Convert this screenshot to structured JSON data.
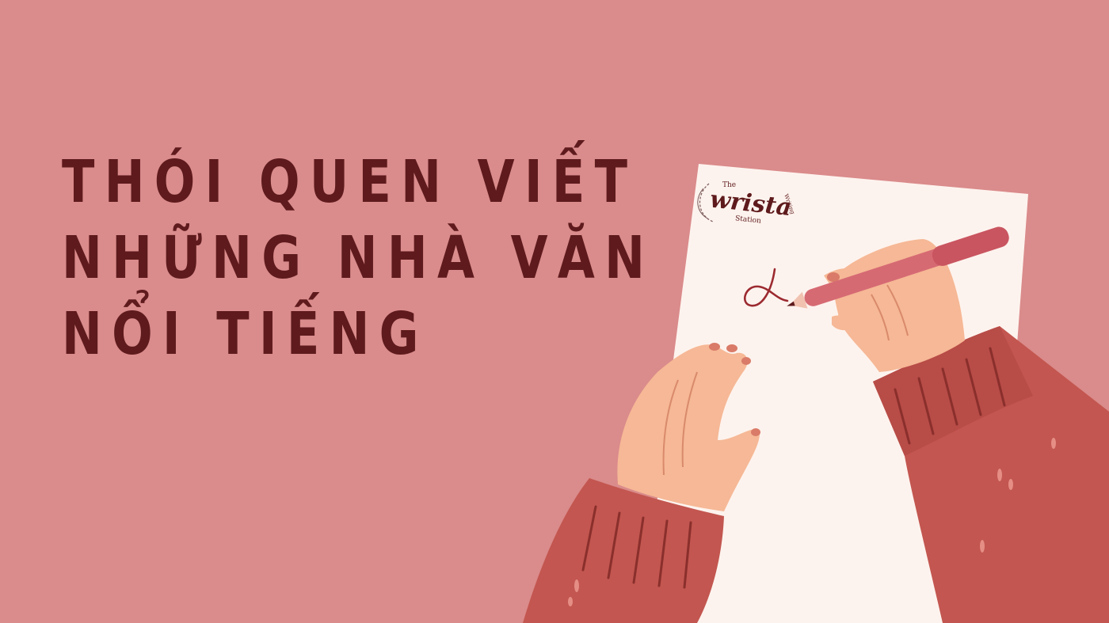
{
  "headline": {
    "lines": [
      "THÓI QUEN VIẾT",
      "NHỮNG NHÀ VĂN",
      "NỔI TIẾNG"
    ]
  },
  "logo": {
    "small_top": "The",
    "main": "wrista",
    "small_right": "Writing",
    "small_bottom": "Station"
  },
  "illustration": {
    "icon": "hands-writing-on-paper",
    "colors": {
      "background": "#da8b8b",
      "title_text": "#5e1a1c",
      "paper": "#fdf3ee",
      "skin": "#f6b896",
      "sleeve": "#c35650",
      "pen": "#d66a73",
      "ink": "#9b2a30"
    }
  }
}
